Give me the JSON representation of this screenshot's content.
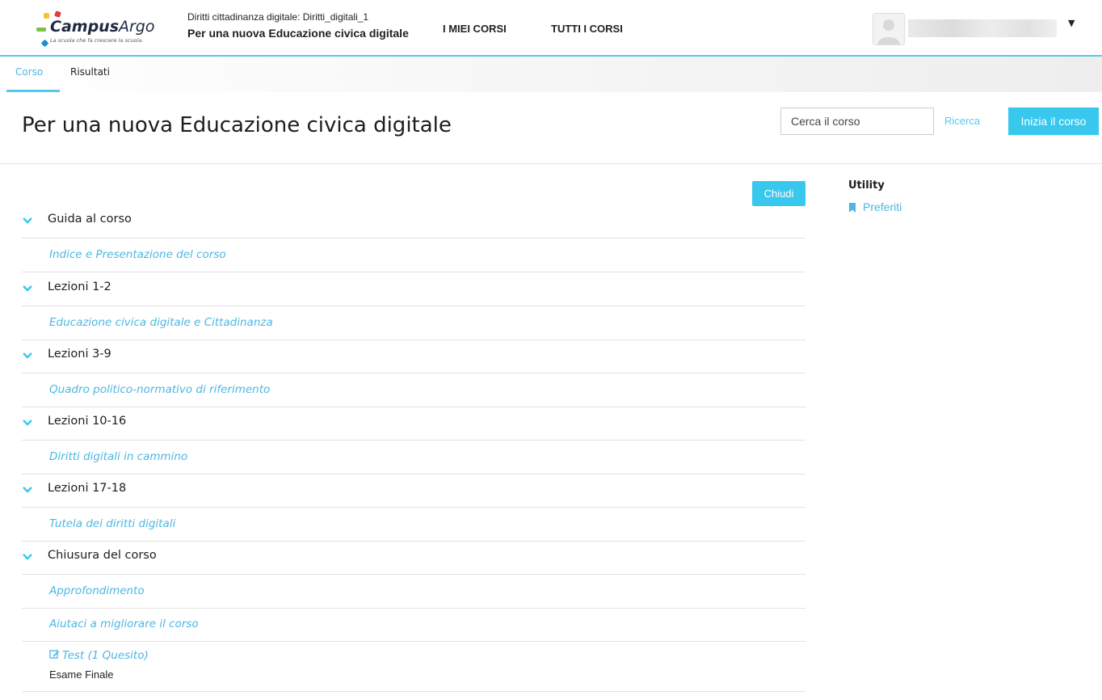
{
  "header": {
    "logo_text_bold": "Campus",
    "logo_text_light": "Argo",
    "logo_tagline": "La scuola che fa crescere la scuola.",
    "course_shortname": "Diritti cittadinanza digitale: Diritti_digitali_1",
    "course_fullname": "Per una nuova Educazione civica digitale",
    "nav": [
      {
        "label": "I MIEI CORSI"
      },
      {
        "label": "TUTTI I CORSI"
      }
    ],
    "user_menu_icon": "chevron-down-icon"
  },
  "tabs": [
    {
      "label": "Corso",
      "active": true
    },
    {
      "label": "Risultati",
      "active": false
    }
  ],
  "page": {
    "title": "Per una nuova Educazione civica digitale",
    "search_placeholder": "Cerca il corso",
    "search_button": "Ricerca",
    "start_button": "Inizia il corso",
    "close_button": "Chiudi"
  },
  "sections": [
    {
      "title": "Guida al corso",
      "activities": [
        {
          "label": "Indice e Presentazione del corso"
        }
      ]
    },
    {
      "title": "Lezioni 1-2",
      "activities": [
        {
          "label": "Educazione civica digitale e Cittadinanza"
        }
      ]
    },
    {
      "title": "Lezioni 3-9",
      "activities": [
        {
          "label": "Quadro politico-normativo di riferimento"
        }
      ]
    },
    {
      "title": "Lezioni 10-16",
      "activities": [
        {
          "label": "Diritti digitali in cammino"
        }
      ]
    },
    {
      "title": "Lezioni 17-18",
      "activities": [
        {
          "label": "Tutela dei diritti digitali"
        }
      ]
    },
    {
      "title": "Chiusura del corso",
      "activities": [
        {
          "label": "Approfondimento"
        },
        {
          "label": "Aiutaci a migliorare il corso"
        },
        {
          "label": "Test (1 Quesito)",
          "description": "Esame Finale",
          "icon": "edit-icon"
        }
      ]
    }
  ],
  "sidebar": {
    "title": "Utility",
    "links": [
      {
        "label": "Preferiti",
        "icon": "bookmark-icon"
      }
    ]
  },
  "colors": {
    "accent": "#38c8ee",
    "link": "#4cb7e3",
    "text": "#1d1d1d"
  }
}
